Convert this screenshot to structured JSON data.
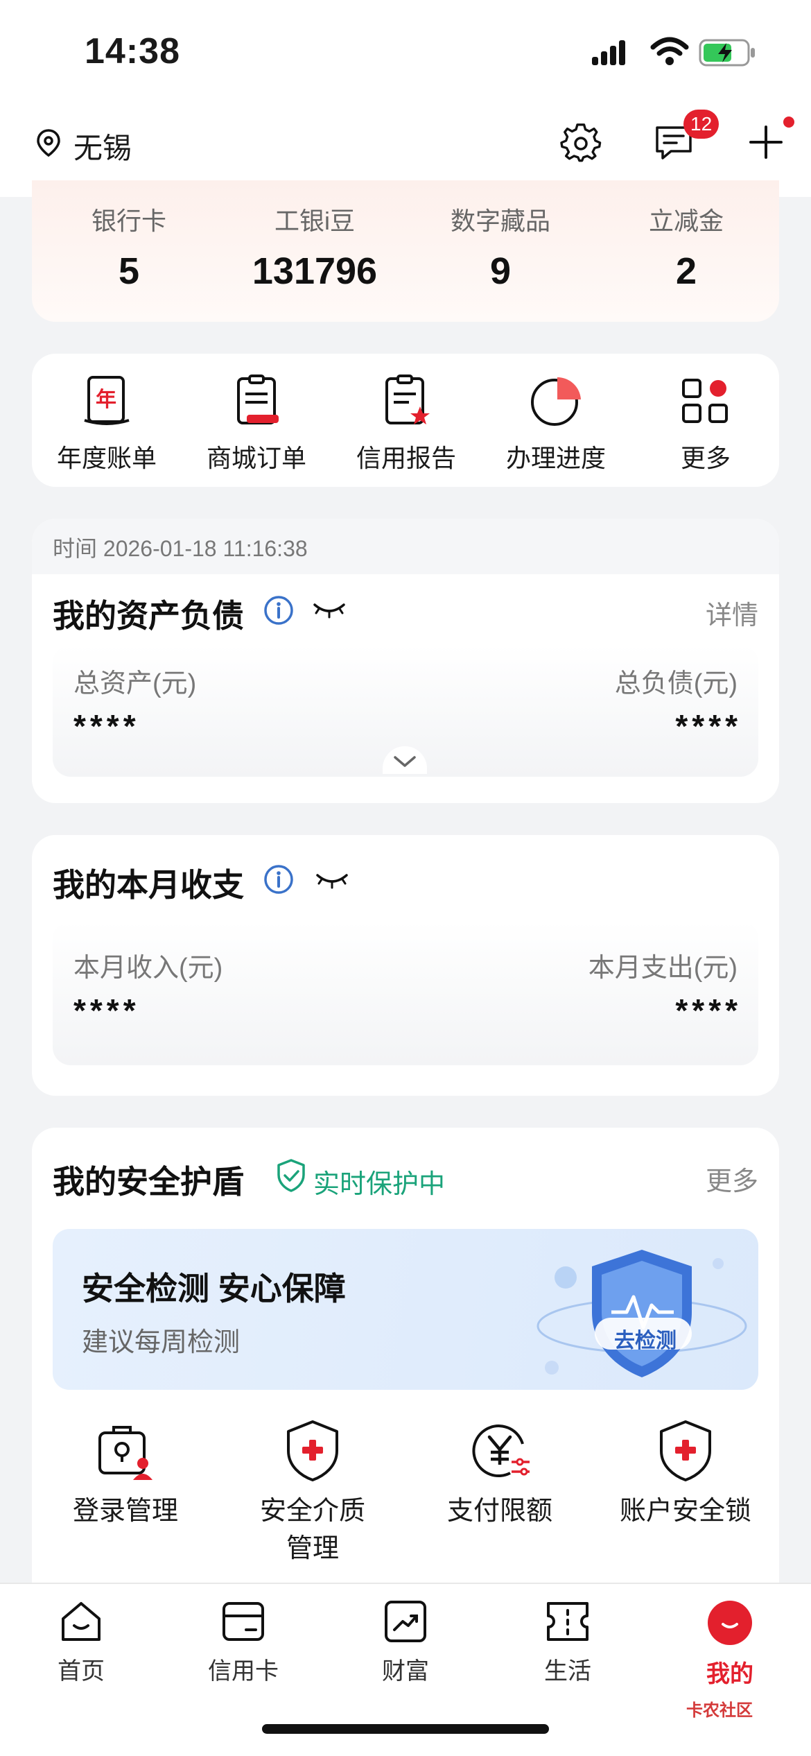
{
  "status_bar": {
    "time": "14:38"
  },
  "header": {
    "city": "无锡",
    "message_badge": "12"
  },
  "assets": [
    {
      "label": "银行卡",
      "value": "5"
    },
    {
      "label": "工银i豆",
      "value": "131796"
    },
    {
      "label": "数字藏品",
      "value": "9"
    },
    {
      "label": "立减金",
      "value": "2"
    }
  ],
  "shortcuts": [
    {
      "label": "年度账单",
      "icon": "annual-bill-icon"
    },
    {
      "label": "商城订单",
      "icon": "mall-order-icon"
    },
    {
      "label": "信用报告",
      "icon": "credit-report-icon"
    },
    {
      "label": "办理进度",
      "icon": "progress-icon"
    },
    {
      "label": "更多",
      "icon": "more-grid-icon"
    }
  ],
  "asset_card": {
    "time_label": "时间 2026-01-18 11:16:38",
    "title": "我的资产负债",
    "detail": "详情",
    "total_assets_label": "总资产(元)",
    "total_assets_value": "****",
    "total_debt_label": "总负债(元)",
    "total_debt_value": "****"
  },
  "month_card": {
    "title": "我的本月收支",
    "income_label": "本月收入(元)",
    "income_value": "****",
    "expense_label": "本月支出(元)",
    "expense_value": "****"
  },
  "shield_card": {
    "title": "我的安全护盾",
    "status": "实时保护中",
    "more": "更多",
    "banner_title": "安全检测 安心保障",
    "banner_sub": "建议每周检测",
    "banner_button": "去检测",
    "items": [
      {
        "label": "登录管理",
        "icon": "login-manage-icon"
      },
      {
        "label": "安全介质\n管理",
        "label_line1": "安全介质",
        "label_line2": "管理",
        "icon": "security-medium-icon"
      },
      {
        "label": "支付限额",
        "icon": "payment-limit-icon"
      },
      {
        "label": "账户安全锁",
        "icon": "account-lock-icon"
      }
    ]
  },
  "tabs": [
    {
      "label": "首页",
      "icon": "home-icon"
    },
    {
      "label": "信用卡",
      "icon": "credit-card-icon"
    },
    {
      "label": "财富",
      "icon": "wealth-icon"
    },
    {
      "label": "生活",
      "icon": "life-ticket-icon"
    },
    {
      "label": "我的",
      "icon": "mine-icon",
      "active": true
    }
  ],
  "watermark": "卡农社区",
  "colors": {
    "accent": "#e3202d",
    "info_blue": "#3a72c9",
    "shield_green": "#1aa37a"
  }
}
